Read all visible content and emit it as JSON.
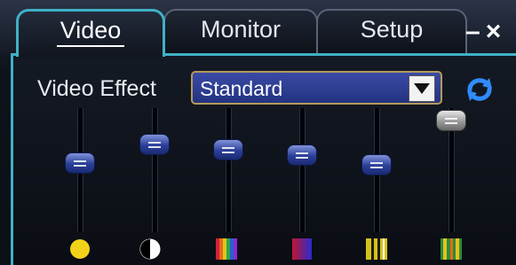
{
  "tabs": [
    {
      "label": "Video",
      "active": true
    },
    {
      "label": "Monitor",
      "active": false
    },
    {
      "label": "Setup",
      "active": false
    }
  ],
  "window_controls": {
    "minimize": "–",
    "close": "×"
  },
  "video_effect": {
    "label": "Video Effect",
    "selected": "Standard"
  },
  "sliders": [
    {
      "name": "brightness",
      "icon": "brightness-icon",
      "level": 0.57
    },
    {
      "name": "contrast",
      "icon": "contrast-icon",
      "level": 0.75
    },
    {
      "name": "hue",
      "icon": "hue-icon",
      "level": 0.7
    },
    {
      "name": "saturation",
      "icon": "saturation-icon",
      "level": 0.65
    },
    {
      "name": "sharpness",
      "icon": "sharpness-icon",
      "level": 0.55
    },
    {
      "name": "gamma",
      "icon": "gamma-icon",
      "level": 0.98
    }
  ],
  "colors": {
    "accent": "#3fb1c6",
    "dropdown_bg": "#2b3b96",
    "dropdown_border": "#b59a5a",
    "slider_thumb": "#3a4fb0",
    "icon_blue": "#2f8cff"
  }
}
